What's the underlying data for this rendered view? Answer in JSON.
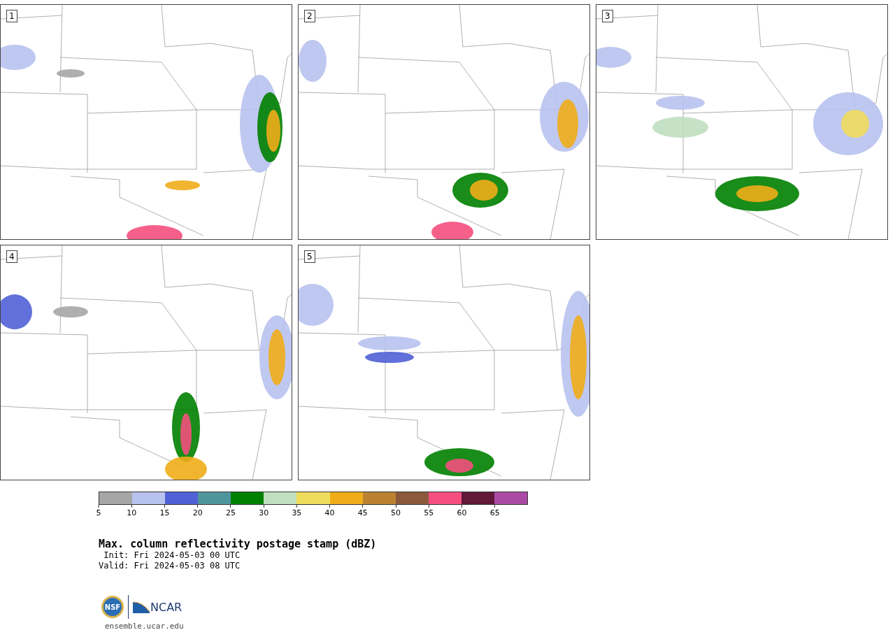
{
  "panels": [
    {
      "number": "1"
    },
    {
      "number": "2"
    },
    {
      "number": "3"
    },
    {
      "number": "4"
    },
    {
      "number": "5"
    }
  ],
  "colorbar": {
    "segments": [
      {
        "color": "#a6a6a6"
      },
      {
        "color": "#b8c2ee"
      },
      {
        "color": "#5061d6"
      },
      {
        "color": "#4f969c"
      },
      {
        "color": "#008000"
      },
      {
        "color": "#c0dfc0"
      },
      {
        "color": "#f0dc5c"
      },
      {
        "color": "#f0ad1a"
      },
      {
        "color": "#bb8232"
      },
      {
        "color": "#8b5a3c"
      },
      {
        "color": "#f44f7e"
      },
      {
        "color": "#621838"
      },
      {
        "color": "#ab4aa5"
      }
    ],
    "ticks": [
      "5",
      "10",
      "15",
      "20",
      "25",
      "30",
      "35",
      "40",
      "45",
      "50",
      "55",
      "60",
      "65"
    ]
  },
  "title": "Max. column reflectivity postage stamp (dBZ)",
  "init": " Init: Fri 2024-05-03 00 UTC",
  "valid": "Valid: Fri 2024-05-03 08 UTC",
  "logos": {
    "nsf": "NSF",
    "ncar": "NCAR"
  },
  "url": "ensemble.ucar.edu"
}
